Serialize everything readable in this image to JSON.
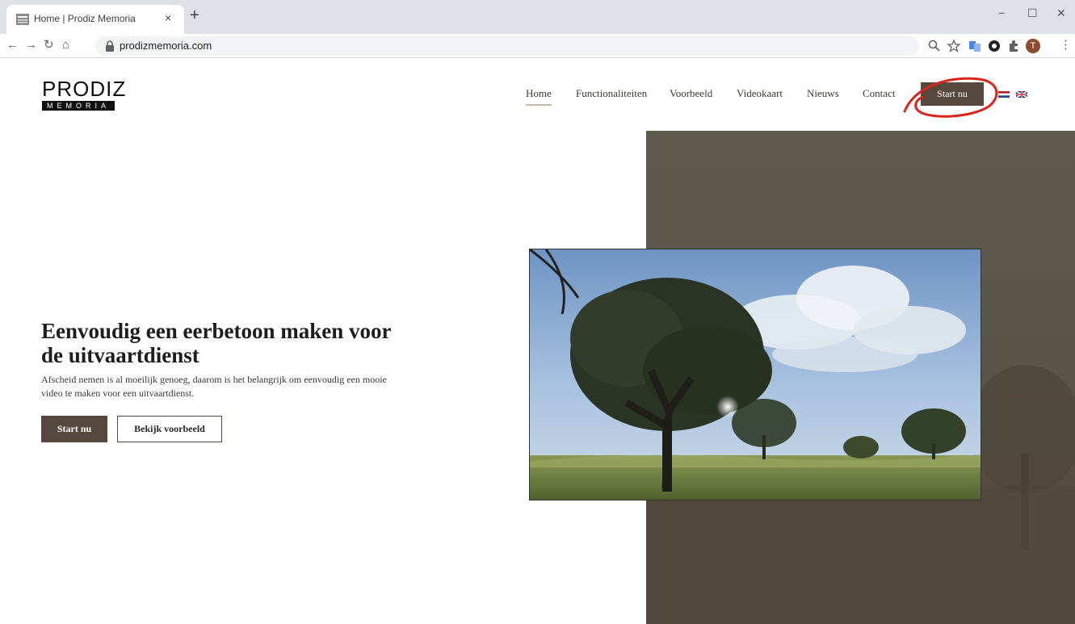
{
  "browser": {
    "tab_title": "Home | Prodiz Memoria",
    "tab_close": "×",
    "new_tab": "+",
    "url": "prodizmemoria.com",
    "window_minimize": "−",
    "window_maximize": "☐",
    "window_close": "✕",
    "profile_initial": "T"
  },
  "site": {
    "logo_top": "PRODIZ",
    "logo_bottom": "MEMORIA",
    "nav": [
      "Home",
      "Functionaliteiten",
      "Voorbeeld",
      "Videokaart",
      "Nieuws",
      "Contact"
    ],
    "nav_active": "Home",
    "cta_top": "Start nu",
    "languages": [
      "nl",
      "en"
    ]
  },
  "hero": {
    "title": "Eenvoudig een eerbetoon maken voor de uitvaartdienst",
    "text": "Afscheid nemen is al moeilijk genoeg, daarom is het belangrijk om eenvoudig een mooie video te maken voor een uitvaartdienst.",
    "primary_button": "Start nu",
    "secondary_button": "Bekijk voorbeeld"
  },
  "colors": {
    "brand_brown": "#57483f",
    "annotation_red": "#d9241c"
  }
}
